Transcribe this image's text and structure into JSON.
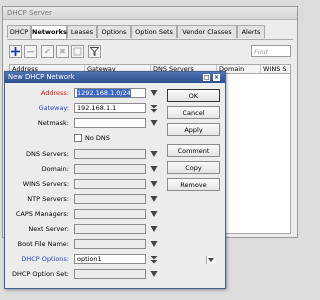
{
  "server_window": {
    "title": "DHCP Server",
    "tabs": [
      "DHCP",
      "Networks",
      "Leases",
      "Options",
      "Option Sets",
      "Vendor Classes",
      "Alerts"
    ],
    "active_tab": "Networks",
    "find_placeholder": "Find",
    "columns": [
      "Address",
      "Gateway",
      "DNS Servers",
      "Domain",
      "WINS S"
    ]
  },
  "dialog": {
    "title": "New DHCP Network",
    "fields": {
      "address": {
        "label": "Address:",
        "value": "1292.168.1.0/24"
      },
      "gateway": {
        "label": "Gateway:",
        "value": "192.168.1.1"
      },
      "netmask": {
        "label": "Netmask:",
        "value": ""
      },
      "no_dns": {
        "label": "No DNS"
      },
      "dns_servers": {
        "label": "DNS Servers:"
      },
      "domain": {
        "label": "Domain:"
      },
      "wins_servers": {
        "label": "WINS Servers:"
      },
      "ntp_servers": {
        "label": "NTP Servers:"
      },
      "caps_managers": {
        "label": "CAPS Managers:"
      },
      "next_server": {
        "label": "Next Server:"
      },
      "boot_file_name": {
        "label": "Boot File Name:"
      },
      "dhcp_options": {
        "label": "DHCP Options:",
        "value": "option1"
      },
      "dhcp_option_set": {
        "label": "DHCP Option Set:"
      }
    },
    "buttons": {
      "ok": "OK",
      "cancel": "Cancel",
      "apply": "Apply",
      "comment": "Comment",
      "copy": "Copy",
      "remove": "Remove"
    }
  }
}
